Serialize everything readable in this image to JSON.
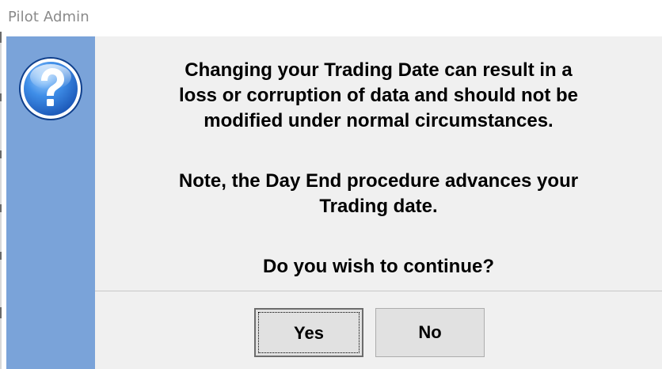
{
  "window": {
    "title": "Pilot Admin"
  },
  "dialog": {
    "icon": "question-icon",
    "message_lines_1": [
      "Changing your Trading Date can result in a",
      "loss or corruption of data and should not be",
      "modified under normal circumstances."
    ],
    "message_lines_2": [
      "Note, the Day End procedure advances your",
      "Trading date."
    ],
    "question": "Do you wish to continue?",
    "buttons": {
      "yes_label": "Yes",
      "no_label": "No"
    }
  },
  "colors": {
    "sidebar": "#7aa3d9",
    "content_background": "#f0f0f0",
    "button_face": "#e1e1e1",
    "title_text": "#8a8a8a"
  }
}
